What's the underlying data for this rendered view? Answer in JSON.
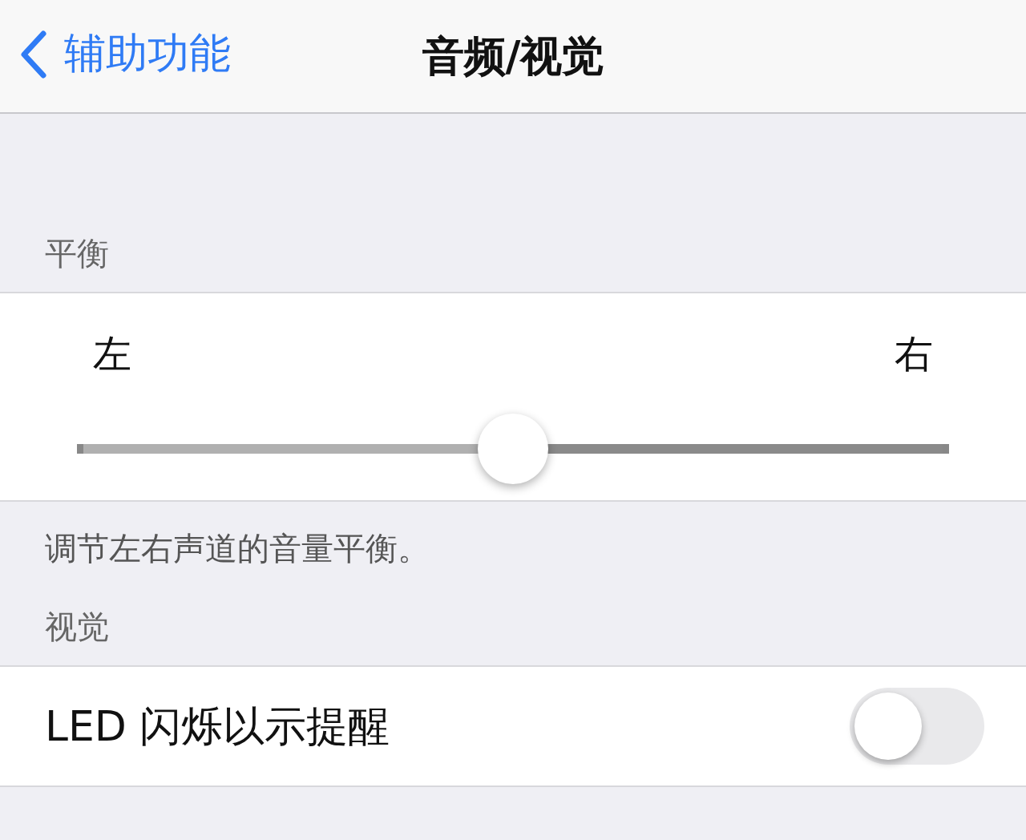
{
  "nav": {
    "back_label": "辅助功能",
    "title": "音频/视觉"
  },
  "balance": {
    "header": "平衡",
    "left_label": "左",
    "right_label": "右",
    "level": 0.5,
    "footer": "调节左右声道的音量平衡。"
  },
  "visual": {
    "header": "视觉",
    "rows": [
      {
        "label": "LED 闪烁以示提醒",
        "kind": "toggle",
        "on": false
      }
    ]
  }
}
